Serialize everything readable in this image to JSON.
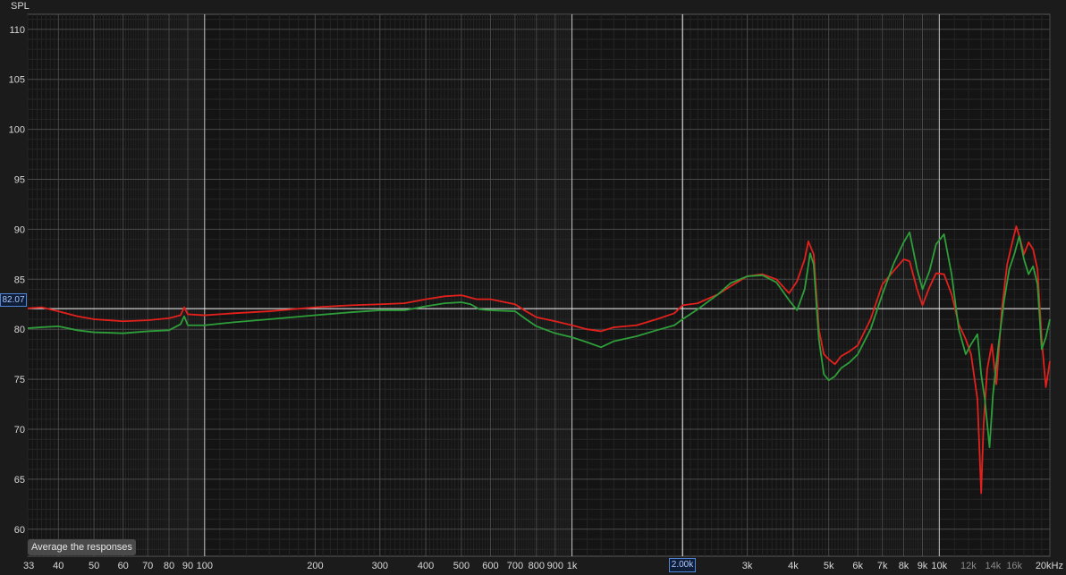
{
  "chart_data": {
    "type": "line",
    "title": "",
    "ylabel": "SPL",
    "xscale": "log",
    "xlim": [
      33,
      20000
    ],
    "ylim": [
      57.3,
      111.5
    ],
    "grid": true,
    "y_ticks": [
      60,
      65,
      70,
      75,
      80,
      85,
      90,
      95,
      100,
      105,
      110
    ],
    "x_ticks": [
      {
        "value": 33,
        "label": "33"
      },
      {
        "value": 40,
        "label": "40"
      },
      {
        "value": 50,
        "label": "50"
      },
      {
        "value": 60,
        "label": "60"
      },
      {
        "value": 70,
        "label": "70"
      },
      {
        "value": 80,
        "label": "80"
      },
      {
        "value": 90,
        "label": "90"
      },
      {
        "value": 100,
        "label": "100"
      },
      {
        "value": 200,
        "label": "200"
      },
      {
        "value": 300,
        "label": "300"
      },
      {
        "value": 400,
        "label": "400"
      },
      {
        "value": 500,
        "label": "500"
      },
      {
        "value": 600,
        "label": "600"
      },
      {
        "value": 700,
        "label": "700"
      },
      {
        "value": 800,
        "label": "800"
      },
      {
        "value": 900,
        "label": "900"
      },
      {
        "value": 1000,
        "label": "1k"
      },
      {
        "value": 3000,
        "label": "3k"
      },
      {
        "value": 4000,
        "label": "4k"
      },
      {
        "value": 5000,
        "label": "5k"
      },
      {
        "value": 6000,
        "label": "6k"
      },
      {
        "value": 7000,
        "label": "7k"
      },
      {
        "value": 8000,
        "label": "8k"
      },
      {
        "value": 9000,
        "label": "9k"
      },
      {
        "value": 10000,
        "label": "10k"
      },
      {
        "value": 12000,
        "label": "12k",
        "dim": true
      },
      {
        "value": 14000,
        "label": "14k",
        "dim": true
      },
      {
        "value": 16000,
        "label": "16k",
        "dim": true
      },
      {
        "value": 20000,
        "label": "20kHz"
      }
    ],
    "cursor": {
      "x": 2000,
      "y": 82.07,
      "x_label": "2.00k",
      "y_label": "82.07"
    },
    "series": [
      {
        "color": "#e3211c",
        "points": [
          [
            33,
            82.1
          ],
          [
            36,
            82.2
          ],
          [
            40,
            81.8
          ],
          [
            45,
            81.3
          ],
          [
            50,
            81.0
          ],
          [
            60,
            80.8
          ],
          [
            70,
            80.9
          ],
          [
            80,
            81.1
          ],
          [
            86,
            81.4
          ],
          [
            88,
            82.2
          ],
          [
            90,
            81.5
          ],
          [
            100,
            81.4
          ],
          [
            120,
            81.6
          ],
          [
            150,
            81.8
          ],
          [
            200,
            82.2
          ],
          [
            250,
            82.4
          ],
          [
            300,
            82.5
          ],
          [
            350,
            82.6
          ],
          [
            400,
            83.0
          ],
          [
            450,
            83.3
          ],
          [
            500,
            83.4
          ],
          [
            550,
            83.0
          ],
          [
            600,
            83.0
          ],
          [
            700,
            82.5
          ],
          [
            750,
            81.8
          ],
          [
            800,
            81.2
          ],
          [
            900,
            80.8
          ],
          [
            1000,
            80.4
          ],
          [
            1100,
            80.0
          ],
          [
            1200,
            79.8
          ],
          [
            1300,
            80.2
          ],
          [
            1500,
            80.4
          ],
          [
            1700,
            81.0
          ],
          [
            1900,
            81.6
          ],
          [
            2000,
            82.4
          ],
          [
            2200,
            82.6
          ],
          [
            2500,
            83.5
          ],
          [
            2700,
            84.3
          ],
          [
            3000,
            85.3
          ],
          [
            3300,
            85.5
          ],
          [
            3600,
            85.0
          ],
          [
            3900,
            83.6
          ],
          [
            4100,
            84.8
          ],
          [
            4300,
            87.0
          ],
          [
            4400,
            88.8
          ],
          [
            4550,
            87.5
          ],
          [
            4700,
            80.0
          ],
          [
            4850,
            77.5
          ],
          [
            5000,
            77.0
          ],
          [
            5200,
            76.5
          ],
          [
            5400,
            77.3
          ],
          [
            5700,
            77.8
          ],
          [
            6000,
            78.4
          ],
          [
            6500,
            81.0
          ],
          [
            7000,
            84.5
          ],
          [
            7500,
            85.8
          ],
          [
            8000,
            87.0
          ],
          [
            8300,
            86.8
          ],
          [
            8700,
            84.0
          ],
          [
            9000,
            82.4
          ],
          [
            9400,
            84.2
          ],
          [
            9800,
            85.6
          ],
          [
            10300,
            85.5
          ],
          [
            10800,
            83.5
          ],
          [
            11300,
            80.5
          ],
          [
            11800,
            79.0
          ],
          [
            12200,
            77.5
          ],
          [
            12700,
            73.0
          ],
          [
            13000,
            63.6
          ],
          [
            13200,
            70.5
          ],
          [
            13500,
            76.0
          ],
          [
            13900,
            78.5
          ],
          [
            14300,
            74.5
          ],
          [
            14800,
            82.0
          ],
          [
            15300,
            86.5
          ],
          [
            15800,
            88.7
          ],
          [
            16200,
            90.3
          ],
          [
            16600,
            89.0
          ],
          [
            17000,
            87.5
          ],
          [
            17500,
            88.7
          ],
          [
            18000,
            88.0
          ],
          [
            18500,
            86.0
          ],
          [
            19000,
            79.0
          ],
          [
            19500,
            74.2
          ],
          [
            20000,
            76.8
          ]
        ]
      },
      {
        "color": "#2e9e3a",
        "points": [
          [
            33,
            80.1
          ],
          [
            36,
            80.2
          ],
          [
            40,
            80.3
          ],
          [
            45,
            79.9
          ],
          [
            50,
            79.7
          ],
          [
            60,
            79.6
          ],
          [
            70,
            79.8
          ],
          [
            80,
            79.9
          ],
          [
            86,
            80.5
          ],
          [
            88,
            81.3
          ],
          [
            90,
            80.4
          ],
          [
            100,
            80.4
          ],
          [
            120,
            80.7
          ],
          [
            150,
            81.0
          ],
          [
            200,
            81.4
          ],
          [
            250,
            81.7
          ],
          [
            300,
            81.9
          ],
          [
            350,
            81.9
          ],
          [
            400,
            82.3
          ],
          [
            450,
            82.6
          ],
          [
            500,
            82.7
          ],
          [
            530,
            82.5
          ],
          [
            560,
            82.0
          ],
          [
            600,
            81.9
          ],
          [
            700,
            81.8
          ],
          [
            750,
            81.0
          ],
          [
            800,
            80.3
          ],
          [
            900,
            79.6
          ],
          [
            1000,
            79.2
          ],
          [
            1100,
            78.7
          ],
          [
            1200,
            78.2
          ],
          [
            1300,
            78.8
          ],
          [
            1500,
            79.3
          ],
          [
            1700,
            79.9
          ],
          [
            1900,
            80.4
          ],
          [
            2000,
            81.0
          ],
          [
            2200,
            82.0
          ],
          [
            2500,
            83.5
          ],
          [
            2700,
            84.6
          ],
          [
            3000,
            85.3
          ],
          [
            3300,
            85.4
          ],
          [
            3600,
            84.7
          ],
          [
            3900,
            82.9
          ],
          [
            4100,
            81.9
          ],
          [
            4300,
            84.0
          ],
          [
            4450,
            87.6
          ],
          [
            4550,
            86.5
          ],
          [
            4700,
            79.0
          ],
          [
            4850,
            75.5
          ],
          [
            5000,
            74.9
          ],
          [
            5200,
            75.3
          ],
          [
            5400,
            76.1
          ],
          [
            5700,
            76.7
          ],
          [
            6000,
            77.5
          ],
          [
            6500,
            80.0
          ],
          [
            7000,
            83.5
          ],
          [
            7500,
            86.5
          ],
          [
            8000,
            88.7
          ],
          [
            8300,
            89.7
          ],
          [
            8700,
            86.0
          ],
          [
            9000,
            84.0
          ],
          [
            9400,
            85.8
          ],
          [
            9800,
            88.5
          ],
          [
            10300,
            89.5
          ],
          [
            10800,
            85.5
          ],
          [
            11300,
            80.0
          ],
          [
            11800,
            77.5
          ],
          [
            12200,
            78.5
          ],
          [
            12700,
            79.5
          ],
          [
            13000,
            75.5
          ],
          [
            13300,
            73.0
          ],
          [
            13700,
            68.2
          ],
          [
            14000,
            73.5
          ],
          [
            14500,
            78.5
          ],
          [
            15000,
            82.8
          ],
          [
            15500,
            86.0
          ],
          [
            16000,
            87.5
          ],
          [
            16500,
            89.3
          ],
          [
            17000,
            87.0
          ],
          [
            17500,
            85.5
          ],
          [
            18000,
            86.3
          ],
          [
            18500,
            84.5
          ],
          [
            19000,
            78.0
          ],
          [
            19500,
            79.2
          ],
          [
            20000,
            81.0
          ]
        ]
      }
    ]
  },
  "button": {
    "average_label": "Average the responses"
  }
}
